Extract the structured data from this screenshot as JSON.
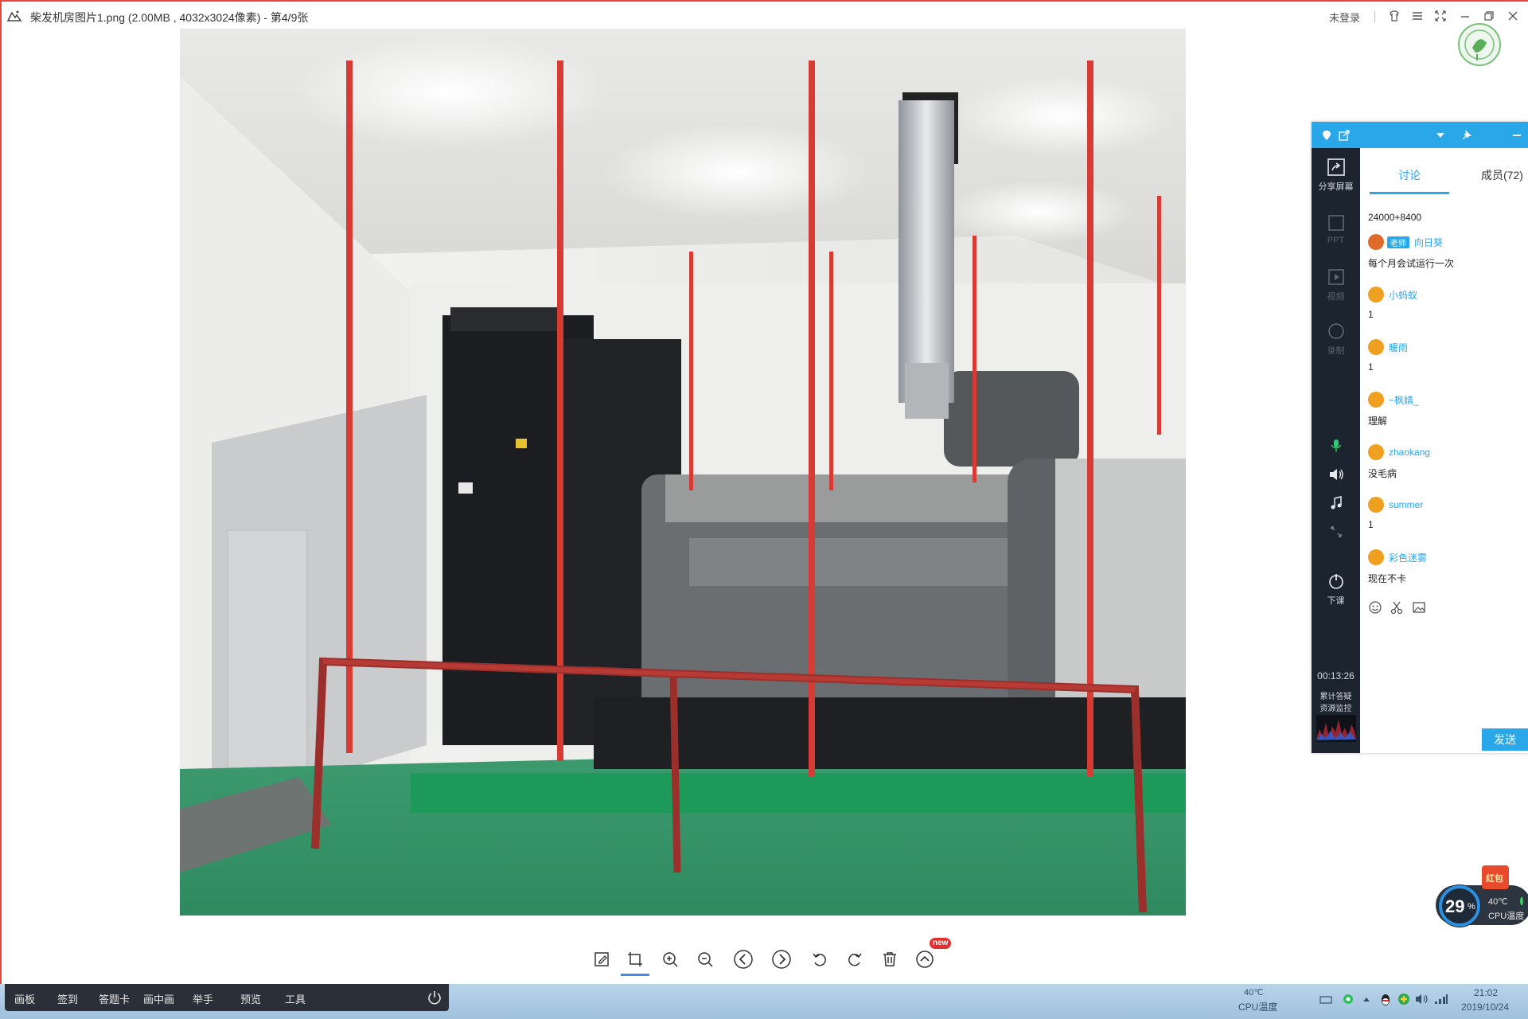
{
  "window": {
    "title": "柴发机房图片1.png (2.00MB , 4032x3024像素) - 第4/9张",
    "login_status": "未登录"
  },
  "viewer_toolbar": {
    "buttons": [
      "edit-icon",
      "crop-icon",
      "zoom-in-icon",
      "zoom-out-icon",
      "previous-icon",
      "next-icon",
      "rotate-left-icon",
      "rotate-right-icon",
      "delete-icon",
      "more-icon"
    ],
    "new_badge": "new"
  },
  "chat_panel": {
    "sidebar": {
      "share_screen": "分享屏幕",
      "ppt": "PPT",
      "video": "视频",
      "record": "录制",
      "leave": "下课",
      "timer": "00:13:26",
      "cumulative": "累计答疑",
      "resource": "资源监控"
    },
    "tabs": {
      "discuss": "讨论",
      "members": "成员(72)"
    },
    "messages": [
      {
        "text": "24000+8400"
      },
      {
        "user": "向日葵",
        "role": "老师",
        "text": "每个月会试运行一次"
      },
      {
        "user": "小蚂蚁",
        "text": "1"
      },
      {
        "user": "暖雨",
        "text": "1"
      },
      {
        "user": "~枫婧_",
        "text": "理解"
      },
      {
        "user": "zhaokang",
        "text": "没毛病"
      },
      {
        "user": "summer",
        "text": "1"
      },
      {
        "user": "彩色迷雾",
        "text": "现在不卡"
      }
    ],
    "send_label": "发送"
  },
  "cpu_widget": {
    "usage": "29",
    "usage_unit": "%",
    "temp": "40℃",
    "temp_label": "CPU温度",
    "badge": "红包"
  },
  "taskbar": {
    "items": [
      "画板",
      "签到",
      "答题卡",
      "画中画",
      "举手",
      "预览",
      "工具"
    ],
    "cpu_temp": "40℃",
    "cpu_label": "CPU温度",
    "time": "21:02",
    "date": "2019/10/24"
  }
}
